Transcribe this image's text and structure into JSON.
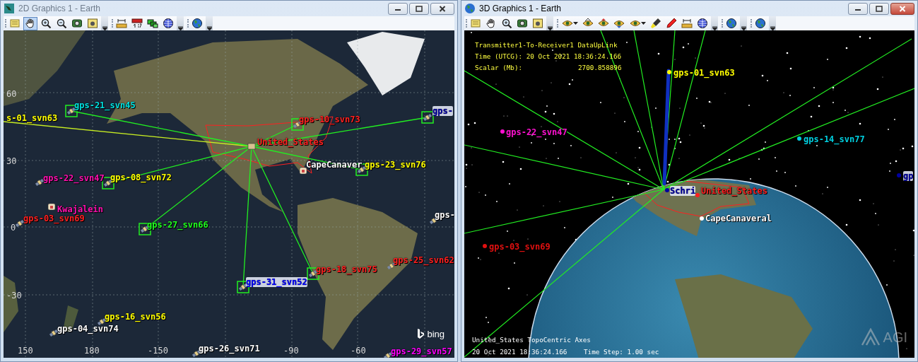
{
  "windows": [
    {
      "title": "2D Graphics 1 - Earth",
      "active": false,
      "kind": "map2d",
      "toolbar": [
        {
          "tools": [
            {
              "kind": "note",
              "selected": false
            },
            {
              "kind": "hand",
              "selected": true
            },
            {
              "kind": "zoom-in",
              "selected": false
            },
            {
              "kind": "zoom-out",
              "selected": false
            },
            {
              "kind": "camera",
              "selected": false
            },
            {
              "kind": "photo",
              "selected": false
            }
          ]
        },
        {
          "tools": [
            {
              "kind": "ruler",
              "selected": false
            },
            {
              "kind": "scale",
              "selected": false
            },
            {
              "kind": "layers",
              "selected": false
            },
            {
              "kind": "globe",
              "selected": false
            }
          ]
        },
        {
          "tools": [
            {
              "kind": "earth",
              "selected": false
            }
          ]
        }
      ],
      "labels": [
        {
          "text": "s-01_svn63",
          "kind": "satellite",
          "color": "#ffff00",
          "boxed": false
        },
        {
          "text": "gps-21_svn45",
          "kind": "satellite",
          "color": "#00e0e0",
          "boxed": true
        },
        {
          "text": "gps-10_svn73",
          "kind": "satellite",
          "color": "#ff2020",
          "boxed": true
        },
        {
          "text": "gps-",
          "kind": "satellite",
          "color": "#0000a0",
          "boxed": true
        },
        {
          "text": "United_States",
          "kind": "region",
          "color": "#ff2020",
          "boxed": false
        },
        {
          "text": "CapeCanaver",
          "kind": "facility",
          "color": "#ffffff",
          "boxed": false
        },
        {
          "text": "gps-23_svn76",
          "kind": "satellite",
          "color": "#ffff00",
          "boxed": true
        },
        {
          "text": "gps-22_svn47",
          "kind": "satellite",
          "color": "#ff10b0",
          "boxed": false
        },
        {
          "text": "gps-08_svn72",
          "kind": "satellite",
          "color": "#ffff00",
          "boxed": true
        },
        {
          "text": "Kwajalein",
          "kind": "facility",
          "color": "#ff10b0",
          "boxed": false
        },
        {
          "text": "gps-03_svn69",
          "kind": "satellite",
          "color": "#ff2020",
          "boxed": false
        },
        {
          "text": "gps-27_svn66",
          "kind": "satellite",
          "color": "#20ff20",
          "boxed": true
        },
        {
          "text": "gps-",
          "kind": "satellite",
          "color": "#ffffff",
          "boxed": false
        },
        {
          "text": "gps-25_svn62",
          "kind": "satellite",
          "color": "#ff2020",
          "boxed": false
        },
        {
          "text": "gps-18_svn75",
          "kind": "satellite",
          "color": "#ff2020",
          "boxed": true
        },
        {
          "text": "gps-31_svn52",
          "kind": "satellite",
          "color": "#0000ff",
          "boxed": true
        },
        {
          "text": "gps-16_svn56",
          "kind": "satellite",
          "color": "#ffff00",
          "boxed": false
        },
        {
          "text": "gps-04_svn74",
          "kind": "satellite",
          "color": "#ffffff",
          "boxed": false
        },
        {
          "text": "gps-26_svn71",
          "kind": "satellite",
          "color": "#ffffff",
          "boxed": false
        },
        {
          "text": "gps-29_svn57",
          "kind": "satellite",
          "color": "#ff00ff",
          "boxed": false
        }
      ],
      "lat_ticks": [
        "60",
        "30",
        "0",
        "-30"
      ],
      "lon_ticks": [
        "150",
        "180",
        "-150",
        "-90",
        "-60"
      ],
      "provider": "bing"
    },
    {
      "title": "3D Graphics 1 - Earth",
      "active": true,
      "kind": "globe3d",
      "toolbar": [
        {
          "tools": [
            {
              "kind": "note",
              "selected": false
            },
            {
              "kind": "hand",
              "selected": false
            },
            {
              "kind": "zoom-in",
              "selected": false
            },
            {
              "kind": "camera",
              "selected": false
            },
            {
              "kind": "photo",
              "selected": false
            }
          ]
        },
        {
          "tools": [
            {
              "kind": "eye-menu",
              "selected": false
            },
            {
              "kind": "eye-home",
              "selected": false
            },
            {
              "kind": "eye-up",
              "selected": false
            },
            {
              "kind": "eye-down",
              "selected": false
            },
            {
              "kind": "eye-menu",
              "selected": false
            },
            {
              "kind": "marker",
              "selected": false
            },
            {
              "kind": "pencil",
              "selected": false
            },
            {
              "kind": "ruler",
              "selected": false
            },
            {
              "kind": "globe",
              "selected": false
            }
          ]
        },
        {
          "tools": [
            {
              "kind": "earth",
              "selected": false
            }
          ]
        },
        {
          "tools": [
            {
              "kind": "earth",
              "selected": false
            }
          ]
        }
      ],
      "info_lines": [
        "Transmitter1-To-Receiver1 DataUpLink",
        "Time (UTCG): 20 Oct 2021 18:36:24.166"
      ],
      "scalar": {
        "label": "Scalar (Mb):",
        "value": "2700.858896"
      },
      "labels": [
        {
          "text": "gps-01_svn63",
          "color": "#ffff00"
        },
        {
          "text": "gps-22_svn47",
          "color": "#ff10d0"
        },
        {
          "text": "gps-14_svn77",
          "color": "#00d0e0"
        },
        {
          "text": "gp",
          "color": "#0000a0"
        },
        {
          "text": "Schri",
          "color": "#0000a0"
        },
        {
          "text": "United_States",
          "color": "#ff2020"
        },
        {
          "text": "CapeCanaveral",
          "color": "#ffffff"
        },
        {
          "text": "gps-03_svn69",
          "color": "#e01010"
        }
      ],
      "axes_label": "United_States TopoCentric Axes",
      "time": "20 Oct 2021 18:36:24.166",
      "time_step": "Time Step: 1.00 sec",
      "logo": "AGI"
    }
  ]
}
